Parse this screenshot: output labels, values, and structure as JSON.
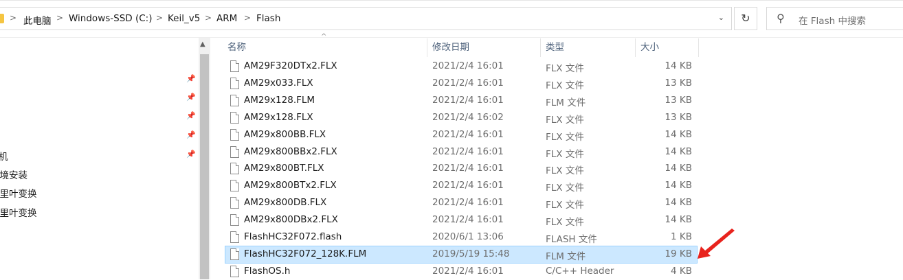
{
  "address_bar": {
    "breadcrumbs": [
      "此电脑",
      "Windows-SSD (C:)",
      "Keil_v5",
      "ARM",
      "Flash"
    ],
    "separator": ">"
  },
  "search": {
    "placeholder": "在 Flash 中搜索"
  },
  "sidebar": {
    "items": [
      {
        "label": "机"
      },
      {
        "label": "环境安装"
      },
      {
        "label": "傅里叶变换"
      },
      {
        "label": "傅里叶变换"
      }
    ]
  },
  "columns": {
    "name": "名称",
    "date": "修改日期",
    "type": "类型",
    "size": "大小"
  },
  "files": [
    {
      "name": "AM29F320DTx2.FLX",
      "date": "2021/2/4 16:01",
      "type": "FLX 文件",
      "size": "14 KB",
      "selected": false
    },
    {
      "name": "AM29x033.FLX",
      "date": "2021/2/4 16:01",
      "type": "FLX 文件",
      "size": "13 KB",
      "selected": false
    },
    {
      "name": "AM29x128.FLM",
      "date": "2021/2/4 16:01",
      "type": "FLM 文件",
      "size": "13 KB",
      "selected": false
    },
    {
      "name": "AM29x128.FLX",
      "date": "2021/2/4 16:02",
      "type": "FLX 文件",
      "size": "13 KB",
      "selected": false
    },
    {
      "name": "AM29x800BB.FLX",
      "date": "2021/2/4 16:01",
      "type": "FLX 文件",
      "size": "14 KB",
      "selected": false
    },
    {
      "name": "AM29x800BBx2.FLX",
      "date": "2021/2/4 16:01",
      "type": "FLX 文件",
      "size": "14 KB",
      "selected": false
    },
    {
      "name": "AM29x800BT.FLX",
      "date": "2021/2/4 16:01",
      "type": "FLX 文件",
      "size": "14 KB",
      "selected": false
    },
    {
      "name": "AM29x800BTx2.FLX",
      "date": "2021/2/4 16:01",
      "type": "FLX 文件",
      "size": "14 KB",
      "selected": false
    },
    {
      "name": "AM29x800DB.FLX",
      "date": "2021/2/4 16:01",
      "type": "FLX 文件",
      "size": "14 KB",
      "selected": false
    },
    {
      "name": "AM29x800DBx2.FLX",
      "date": "2021/2/4 16:01",
      "type": "FLX 文件",
      "size": "14 KB",
      "selected": false
    },
    {
      "name": "FlashHC32F072.flash",
      "date": "2020/6/1 13:06",
      "type": "FLASH 文件",
      "size": "1 KB",
      "selected": false
    },
    {
      "name": "FlashHC32F072_128K.FLM",
      "date": "2019/5/19 15:48",
      "type": "FLM 文件",
      "size": "19 KB",
      "selected": true
    },
    {
      "name": "FlashOS.h",
      "date": "2021/2/4 16:01",
      "type": "C/C++ Header",
      "size": "4 KB",
      "selected": false
    }
  ],
  "colors": {
    "selection": "#cce8ff",
    "selection_border": "#99d1ff",
    "annotation_arrow": "#e8231d"
  },
  "icons": [
    "folder-icon",
    "chevron-right-icon",
    "chevron-down-icon",
    "refresh-icon",
    "search-icon",
    "pin-icon",
    "file-icon",
    "sort-caret-icon",
    "scroll-up-icon"
  ]
}
